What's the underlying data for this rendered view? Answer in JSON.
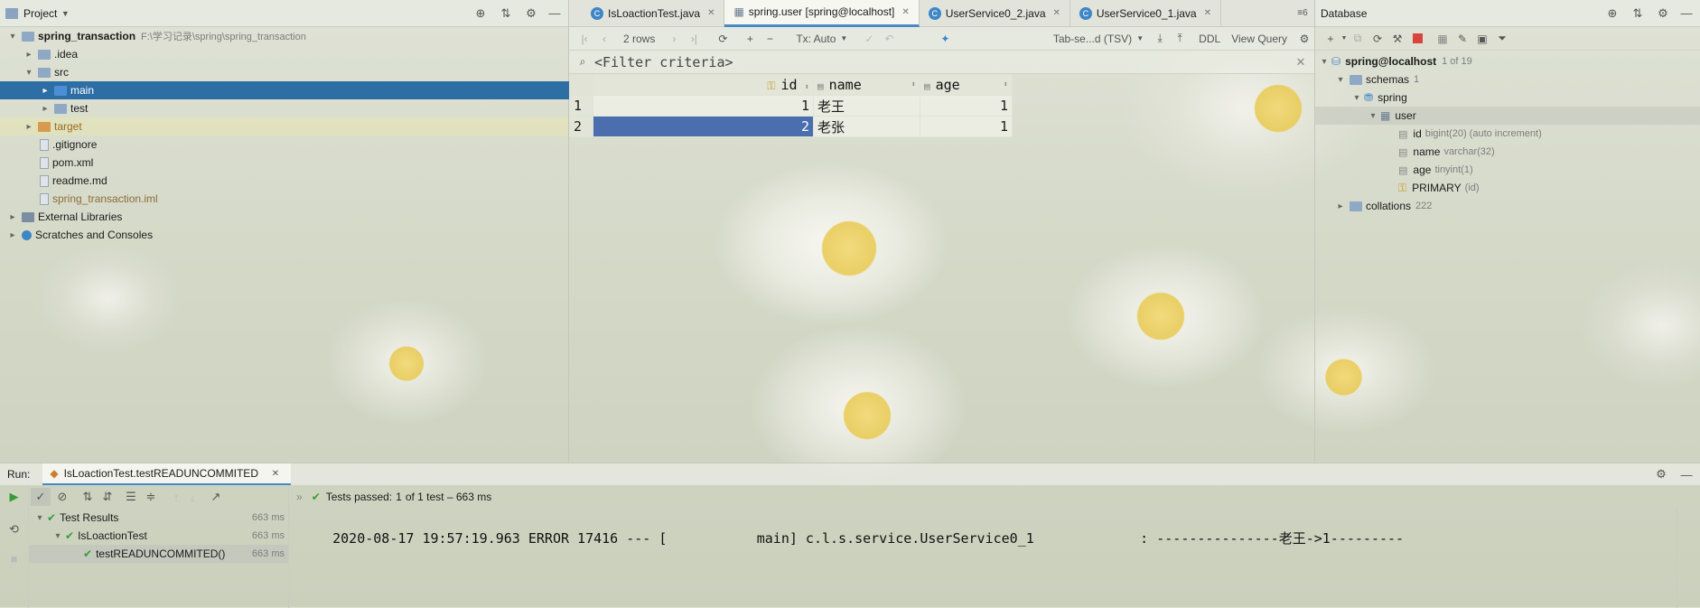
{
  "project": {
    "title": "Project",
    "root": {
      "name": "spring_transaction",
      "path": "F:\\学习记录\\spring\\spring_transaction"
    },
    "items": [
      {
        "name": ".idea",
        "level": 1,
        "kind": "folder"
      },
      {
        "name": "src",
        "level": 1,
        "kind": "folder",
        "open": true
      },
      {
        "name": "main",
        "level": 2,
        "kind": "folder-blue",
        "selected": true
      },
      {
        "name": "test",
        "level": 2,
        "kind": "folder"
      },
      {
        "name": "target",
        "level": 1,
        "kind": "folder-orange"
      },
      {
        "name": ".gitignore",
        "level": 1,
        "kind": "file"
      },
      {
        "name": "pom.xml",
        "level": 1,
        "kind": "file"
      },
      {
        "name": "readme.md",
        "level": 1,
        "kind": "file"
      },
      {
        "name": "spring_transaction.iml",
        "level": 1,
        "kind": "file"
      },
      {
        "name": "External Libraries",
        "level": 0,
        "kind": "lib"
      },
      {
        "name": "Scratches and Consoles",
        "level": 0,
        "kind": "scratch"
      }
    ]
  },
  "tabs": [
    {
      "label": "IsLoactionTest.java",
      "active": false
    },
    {
      "label": "spring.user [spring@localhost]",
      "active": true
    },
    {
      "label": "UserService0_2.java",
      "active": false
    },
    {
      "label": "UserService0_1.java",
      "active": false
    }
  ],
  "toolbar": {
    "rows": "2 rows",
    "tx": "Tx: Auto",
    "format": "Tab-se...d (TSV)",
    "ddl": "DDL",
    "view_query": "View Query"
  },
  "filter": {
    "placeholder": "<Filter criteria>"
  },
  "table": {
    "columns": [
      "id",
      "name",
      "age"
    ],
    "rows": [
      {
        "num": "1",
        "id": "1",
        "name": "老王",
        "age": "1"
      },
      {
        "num": "2",
        "id": "2",
        "name": "老张",
        "age": "1"
      }
    ]
  },
  "database": {
    "title": "Database",
    "host": "spring@localhost",
    "host_count": "1 of 19",
    "schemas": "schemas",
    "schemas_count": "1",
    "schema": "spring",
    "table": "user",
    "columns": [
      {
        "name": "id",
        "type": "bigint(20) (auto increment)"
      },
      {
        "name": "name",
        "type": "varchar(32)"
      },
      {
        "name": "age",
        "type": "tinyint(1)"
      },
      {
        "name": "PRIMARY",
        "type": "(id)"
      }
    ],
    "collations": "collations",
    "collations_count": "222"
  },
  "run": {
    "label": "Run:",
    "tab": "IsLoactionTest.testREADUNCOMMITED",
    "status_prefix": "Tests passed:",
    "status_value": "1",
    "status_suffix": "of 1 test – 663 ms",
    "tree": [
      {
        "name": "Test Results",
        "time": "663 ms",
        "level": 0
      },
      {
        "name": "IsLoactionTest",
        "time": "663 ms",
        "level": 1
      },
      {
        "name": "testREADUNCOMMITED()",
        "time": "663 ms",
        "level": 2
      }
    ],
    "console": "2020-08-17 19:57:19.963 ERROR 17416 --- [           main] c.l.s.service.UserService0_1             : ---------------老王->1---------"
  }
}
